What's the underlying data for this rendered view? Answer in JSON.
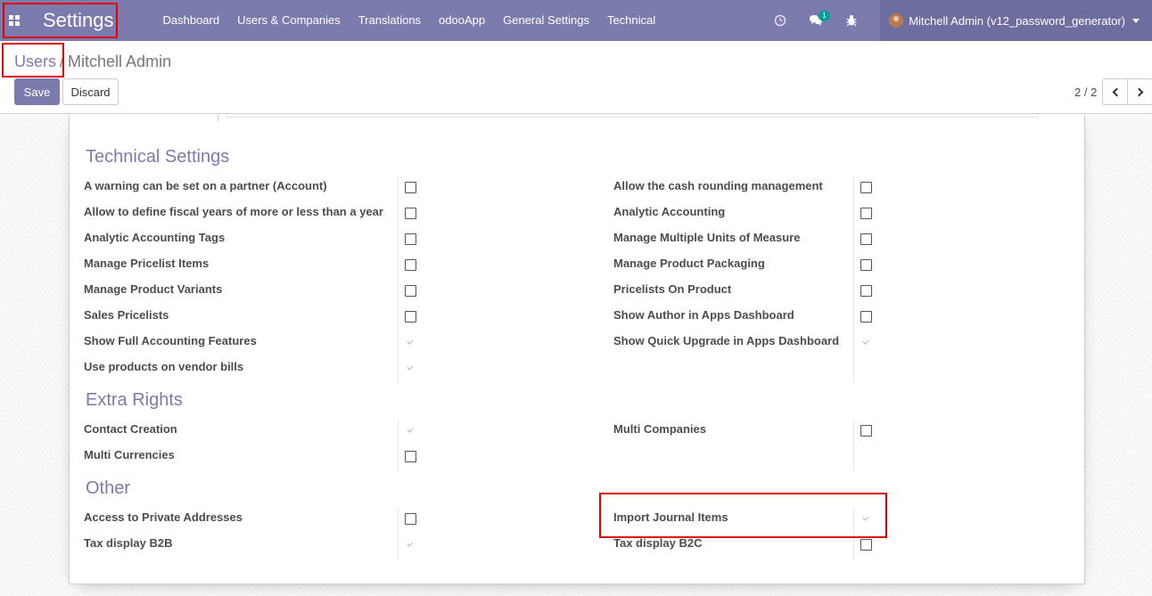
{
  "navbar": {
    "brand": "Settings",
    "menu": [
      "Dashboard",
      "Users & Companies",
      "Translations",
      "odooApp",
      "General Settings",
      "Technical"
    ],
    "chat_badge": "1",
    "user": "Mitchell Admin (v12_password_generator)",
    "color": "#7c7bad"
  },
  "breadcrumb": {
    "parent": "Users",
    "separator": "/",
    "current": "Mitchell Admin"
  },
  "buttons": {
    "save": "Save",
    "discard": "Discard"
  },
  "pager": {
    "value": "2 / 2"
  },
  "sections": {
    "technical": {
      "title": "Technical Settings",
      "left": [
        {
          "label": "A warning can be set on a partner (Account)",
          "checked": false
        },
        {
          "label": "Allow to define fiscal years of more or less than a year",
          "checked": false
        },
        {
          "label": "Analytic Accounting Tags",
          "checked": false
        },
        {
          "label": "Manage Pricelist Items",
          "checked": false
        },
        {
          "label": "Manage Product Variants",
          "checked": false
        },
        {
          "label": "Sales Pricelists",
          "checked": false
        },
        {
          "label": "Show Full Accounting Features",
          "checked": true
        },
        {
          "label": "Use products on vendor bills",
          "checked": true
        }
      ],
      "right": [
        {
          "label": "Allow the cash rounding management",
          "checked": false
        },
        {
          "label": "Analytic Accounting",
          "checked": false
        },
        {
          "label": "Manage Multiple Units of Measure",
          "checked": false
        },
        {
          "label": "Manage Product Packaging",
          "checked": false
        },
        {
          "label": "Pricelists On Product",
          "checked": false
        },
        {
          "label": "Show Author in Apps Dashboard",
          "checked": false
        },
        {
          "label": "Show Quick Upgrade in Apps Dashboard",
          "checked": true
        }
      ]
    },
    "extra": {
      "title": "Extra Rights",
      "left": [
        {
          "label": "Contact Creation",
          "checked": true
        },
        {
          "label": "Multi Currencies",
          "checked": false
        }
      ],
      "right": [
        {
          "label": "Multi Companies",
          "checked": false
        }
      ]
    },
    "other": {
      "title": "Other",
      "left": [
        {
          "label": "Access to Private Addresses",
          "checked": false
        },
        {
          "label": "Tax display B2B",
          "checked": true
        }
      ],
      "right": [
        {
          "label": "Import Journal Items",
          "checked": true
        },
        {
          "label": "Tax display B2C",
          "checked": false
        }
      ]
    }
  },
  "annotation_color": "#e00000"
}
